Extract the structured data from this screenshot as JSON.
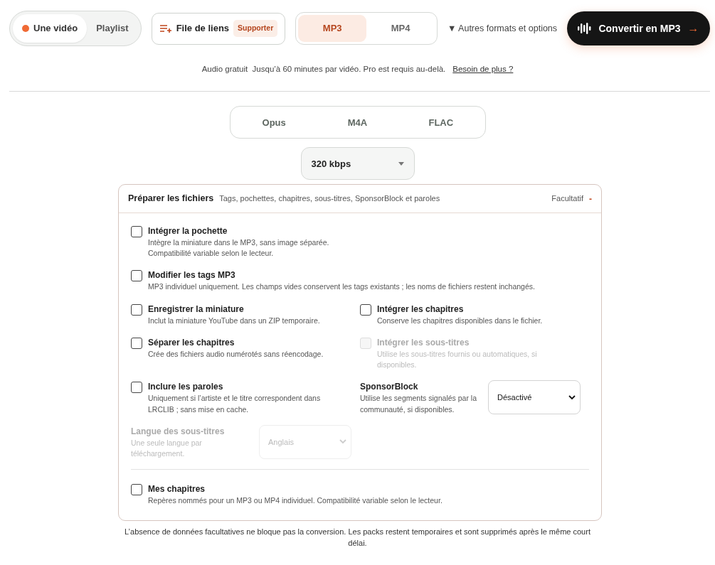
{
  "mode_toggle": [
    {
      "label": "Une vidéo",
      "selected": true
    },
    {
      "label": "Playlist",
      "selected": false
    }
  ],
  "link_file_button": {
    "label": "File de liens",
    "badge": "Supporter"
  },
  "format_tabs": [
    {
      "label": "MP3",
      "selected": true
    },
    {
      "label": "MP4",
      "selected": false
    }
  ],
  "more_options": {
    "caret": "▼",
    "label": "Autres formats et options"
  },
  "convert_button": {
    "label": "Convertir en MP3",
    "arrow": "→"
  },
  "info": {
    "text": "Audio gratuit  Jusqu’à 60 minutes par vidéo. Pro est requis au-delà.",
    "link": "Besoin de plus ?"
  },
  "audio_formats": [
    {
      "label": "Opus",
      "selected": false
    },
    {
      "label": "M4A",
      "selected": false
    },
    {
      "label": "FLAC",
      "selected": false
    }
  ],
  "bitrate_select": {
    "value": "320 kbps"
  },
  "options_card": {
    "title": "Préparer les fichiers",
    "subtitle": "Tags, pochettes, chapitres, sous-titres, SponsorBlock et paroles",
    "status": "Facultatif",
    "collapse": "-",
    "rows": [
      {
        "items": [
          {
            "kind": "checkbox",
            "label": "Intégrer la pochette",
            "description": [
              "Intègre la miniature dans le MP3, sans image séparée.",
              "Compatibilité variable selon le lecteur."
            ],
            "checked": false,
            "disabled": false
          }
        ]
      },
      {
        "items": [
          {
            "kind": "checkbox",
            "label": "Modifier les tags MP3",
            "description": [
              "MP3 individuel uniquement. Les champs vides conservent les tags existants ; les noms de fichiers restent inchangés."
            ],
            "checked": false,
            "disabled": false
          }
        ]
      },
      {
        "items": [
          {
            "kind": "checkbox",
            "label": "Enregistrer la miniature",
            "description": [
              "Inclut la miniature YouTube dans un ZIP temporaire."
            ],
            "checked": false,
            "disabled": false
          },
          {
            "kind": "checkbox",
            "label": "Intégrer les chapitres",
            "description": [
              "Conserve les chapitres disponibles dans le fichier."
            ],
            "checked": false,
            "disabled": false
          }
        ]
      },
      {
        "items": [
          {
            "kind": "checkbox",
            "label": "Séparer les chapitres",
            "description": [
              "Crée des fichiers audio numérotés sans réencodage."
            ],
            "checked": false,
            "disabled": false
          },
          {
            "kind": "checkbox",
            "label": "Intégrer les sous-titres",
            "description": [
              "Utilise les sous-titres fournis ou automatiques, si disponibles."
            ],
            "checked": false,
            "disabled": true
          }
        ]
      },
      {
        "items": [
          {
            "kind": "checkbox",
            "label": "Inclure les paroles",
            "description": [
              "Uniquement si l’artiste et le titre correspondent dans LRCLIB ; sans mise en cache."
            ],
            "checked": false,
            "disabled": false
          },
          {
            "kind": "select",
            "label": "SponsorBlock",
            "description": [
              "Utilise les segments signalés par la communauté, si disponibles."
            ],
            "value": "Désactivé",
            "disabled": false
          }
        ]
      },
      {
        "items": [
          {
            "kind": "select",
            "label": "Langue des sous-titres",
            "description": [
              "Une seule langue par téléchargement."
            ],
            "value": "Anglais",
            "disabled": true
          }
        ]
      }
    ],
    "footer_option": {
      "kind": "checkbox",
      "label": "Mes chapitres",
      "description": [
        "Repères nommés pour un MP3 ou MP4 individuel. Compatibilité variable selon le lecteur."
      ],
      "checked": false,
      "disabled": false
    }
  },
  "footer_note": "L’absence de données facultatives ne bloque pas la conversion. Les packs restent temporaires et sont supprimés après le même court délai."
}
